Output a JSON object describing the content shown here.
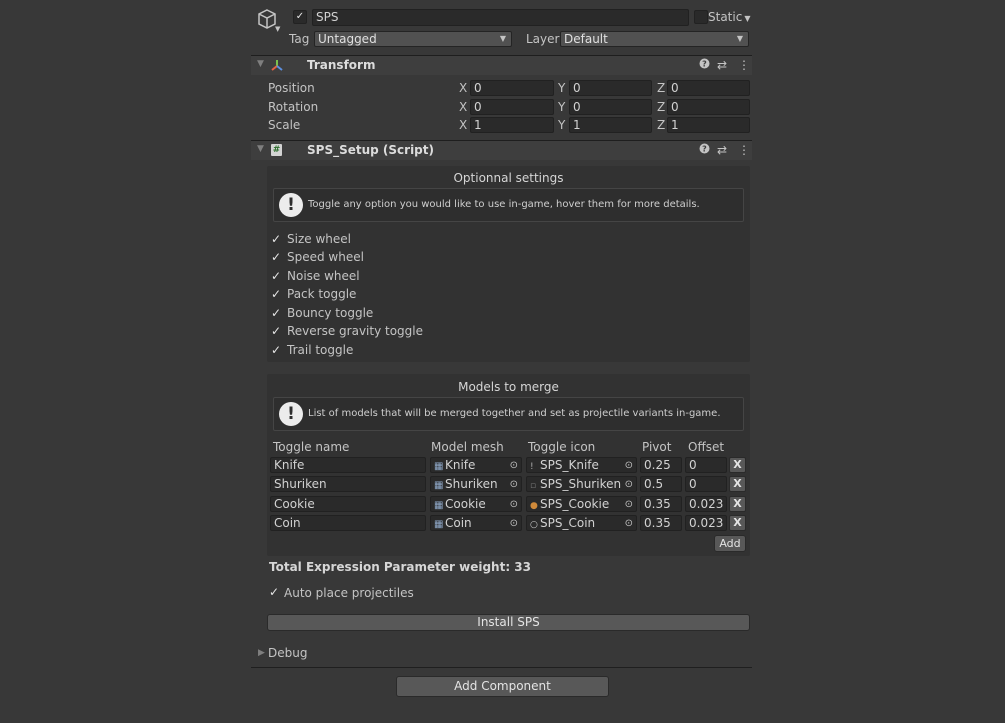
{
  "object": {
    "name": "SPS",
    "active_checked": true,
    "static_label": "Static",
    "tag_label": "Tag",
    "tag_value": "Untagged",
    "layer_label": "Layer",
    "layer_value": "Default"
  },
  "transform": {
    "title": "Transform",
    "rows": [
      {
        "label": "Position",
        "x": "0",
        "y": "0",
        "z": "0"
      },
      {
        "label": "Rotation",
        "x": "0",
        "y": "0",
        "z": "0"
      },
      {
        "label": "Scale",
        "x": "1",
        "y": "1",
        "z": "1"
      }
    ],
    "axes": {
      "x": "X",
      "y": "Y",
      "z": "Z"
    }
  },
  "script": {
    "title": "SPS_Setup (Script)",
    "optional": {
      "title": "Optionnal settings",
      "help": "Toggle any option you would like to use in-game, hover them for more details.",
      "toggles": [
        {
          "label": "Size wheel",
          "checked": true
        },
        {
          "label": "Speed wheel",
          "checked": true
        },
        {
          "label": "Noise wheel",
          "checked": true
        },
        {
          "label": "Pack toggle",
          "checked": true
        },
        {
          "label": "Bouncy toggle",
          "checked": true
        },
        {
          "label": "Reverse gravity toggle",
          "checked": true
        },
        {
          "label": "Trail toggle",
          "checked": true
        }
      ]
    },
    "models": {
      "title": "Models to merge",
      "help": "List of models that will be merged together and set as projectile variants in-game.",
      "headers": {
        "name": "Toggle name",
        "mesh": "Model mesh",
        "icon": "Toggle icon",
        "pivot": "Pivot",
        "offset": "Offset"
      },
      "rows": [
        {
          "name": "Knife",
          "mesh": "Knife",
          "icon": "SPS_Knife",
          "icon_glyph": "!",
          "pivot": "0.25",
          "offset": "0",
          "remove": "X"
        },
        {
          "name": "Shuriken",
          "mesh": "Shuriken",
          "icon": "SPS_Shuriken",
          "icon_glyph": "▫",
          "pivot": "0.5",
          "offset": "0",
          "remove": "X"
        },
        {
          "name": "Cookie",
          "mesh": "Cookie",
          "icon": "SPS_Cookie",
          "icon_glyph": "●",
          "pivot": "0.35",
          "offset": "0.023",
          "remove": "X"
        },
        {
          "name": "Coin",
          "mesh": "Coin",
          "icon": "SPS_Coin",
          "icon_glyph": "○",
          "pivot": "0.35",
          "offset": "0.023",
          "remove": "X"
        }
      ],
      "add_label": "Add"
    },
    "total_weight": "Total Expression Parameter weight: 33",
    "auto_place": {
      "label": "Auto place projectiles",
      "checked": true
    },
    "install_label": "Install SPS",
    "debug_label": "Debug"
  },
  "add_component_label": "Add Component",
  "check_glyph": "✓",
  "colors": {
    "background": "#383838",
    "field": "#2a2a2a",
    "header": "#3e3e3e",
    "button": "#585858"
  }
}
